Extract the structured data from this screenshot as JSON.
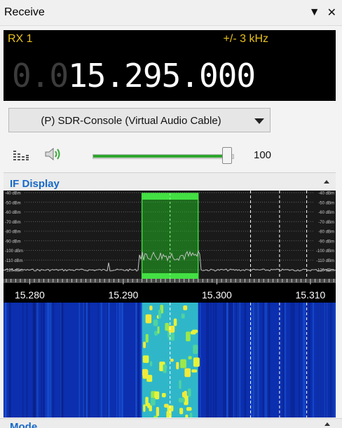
{
  "window": {
    "title": "Receive"
  },
  "receiver": {
    "name": "RX 1",
    "bandwidth": "+/- 3 kHz",
    "frequency_dim": "0.0",
    "frequency_bright": "15.295.000"
  },
  "audio": {
    "device": "(P) SDR-Console (Virtual Audio Cable)",
    "volume": 100,
    "volume_fraction": 0.96
  },
  "if_display": {
    "label": "IF Display",
    "dbm_labels": [
      "-40 dBm",
      "-50 dBm",
      "-60 dBm",
      "-70 dBm",
      "-80 dBm",
      "-90 dBm",
      "-100 dBm",
      "-110 dBm",
      "-120 dBm"
    ],
    "freq_labels": [
      "15.280",
      "15.290",
      "15.300",
      "15.310"
    ],
    "freq_range_mhz": [
      15.2772,
      15.3127
    ],
    "passband_mhz": [
      15.292,
      15.298
    ],
    "center_mhz": 15.295,
    "marker_lines_mhz": [
      15.3036,
      15.3067,
      15.3096
    ],
    "colors": {
      "passband": "#22b322",
      "trace": "#bfbfbf",
      "marker": "#ffffff"
    }
  },
  "bottom_section": {
    "label": "Mode"
  }
}
